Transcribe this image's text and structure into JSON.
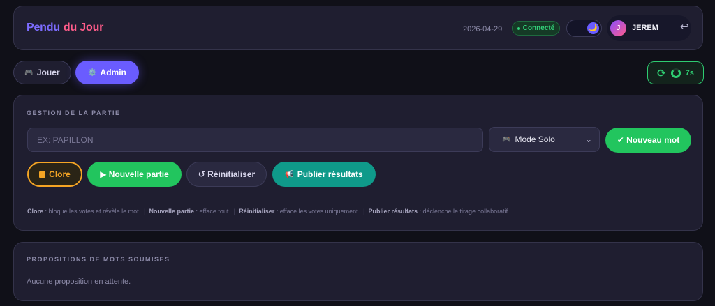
{
  "header": {
    "brand_part1": "Pendu",
    "brand_part2": "du Jour",
    "date": "2026-04-29",
    "status": "Connecté",
    "theme_icon": "🌙",
    "user_initial": "J",
    "username": "JEREM",
    "logout_icon": "↩"
  },
  "tabs": [
    {
      "icon": "🎮",
      "label": "Jouer"
    },
    {
      "icon": "⚙️",
      "label": "Admin"
    }
  ],
  "timer": {
    "refresh_icon": "⟳",
    "seconds": "7s"
  },
  "gestion": {
    "title": "GESTION DE LA PARTIE",
    "word_placeholder": "EX: PAPILLON",
    "mode_icon": "🎮",
    "mode_value": "Mode Solo",
    "new_word_label": "✔ Nouveau mot",
    "buttons": {
      "clore": "Clore",
      "nouvelle": "▶ Nouvelle partie",
      "reinit": "↺ Réinitialiser",
      "publier_icon": "📢",
      "publier": "Publier résultats"
    },
    "help": [
      {
        "term": "Clore",
        "desc": " : bloque les votes et révèle le mot."
      },
      {
        "term": "Nouvelle partie",
        "desc": " : efface tout."
      },
      {
        "term": "Réinitialiser",
        "desc": " : efface les votes uniquement."
      },
      {
        "term": "Publier résultats",
        "desc": " : déclenche le tirage collaboratif."
      }
    ],
    "help_separator": "|"
  },
  "propositions": {
    "title": "PROPOSITIONS DE MOTS SOUMISES",
    "empty": "Aucune proposition en attente."
  },
  "colors": {
    "accent": "#6a5cff",
    "success": "#22c55e",
    "warning": "#f5a524",
    "teal": "#0f9a8a",
    "brand_pink": "#ff5c8a"
  }
}
